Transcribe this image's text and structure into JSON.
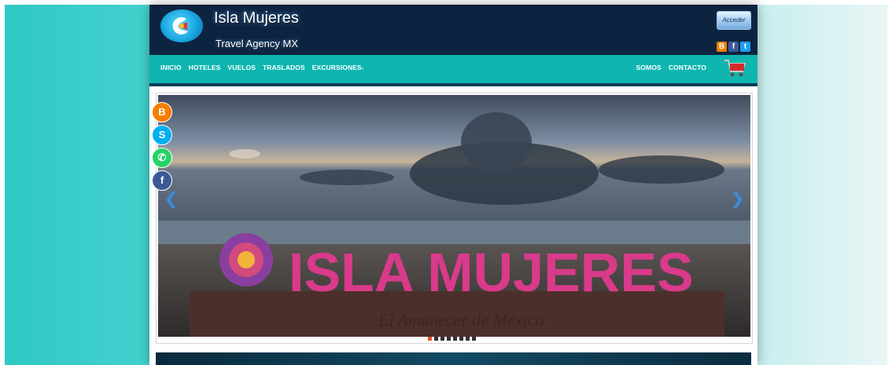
{
  "header": {
    "title": "Isla Mujeres",
    "subtitle": "Travel Agency MX",
    "login_label": "Acceder",
    "social_top": [
      {
        "icon": "blogger-icon",
        "glyph": "B",
        "color": "#f57d00"
      },
      {
        "icon": "facebook-icon",
        "glyph": "f",
        "color": "#3b5998"
      },
      {
        "icon": "twitter-icon",
        "glyph": "t",
        "color": "#1da1f2"
      }
    ]
  },
  "nav": {
    "left": [
      "INICIO",
      "HOTELES",
      "VUELOS",
      "TRASLADOS",
      "EXCURSIONES-"
    ],
    "right": [
      "SOMOS",
      "CONTACTO"
    ],
    "cart_icon": "shopping-cart-icon"
  },
  "slider": {
    "sign_text": "ISLA MUJERES",
    "sign_subtext": "El Amanecer de México",
    "slides_total": 8,
    "active_slide": 1
  },
  "side_social": [
    {
      "icon": "blogger-icon",
      "glyph": "B",
      "color": "#f57d00"
    },
    {
      "icon": "skype-icon",
      "glyph": "S",
      "color": "#00aff0"
    },
    {
      "icon": "whatsapp-icon",
      "glyph": "✆",
      "color": "#25d366"
    },
    {
      "icon": "facebook-icon",
      "glyph": "f",
      "color": "#3b5998"
    }
  ],
  "colors": {
    "header_bg": "#0d2440",
    "nav_bg": "#0fb6b0",
    "page_bg": "#45d2cf"
  }
}
